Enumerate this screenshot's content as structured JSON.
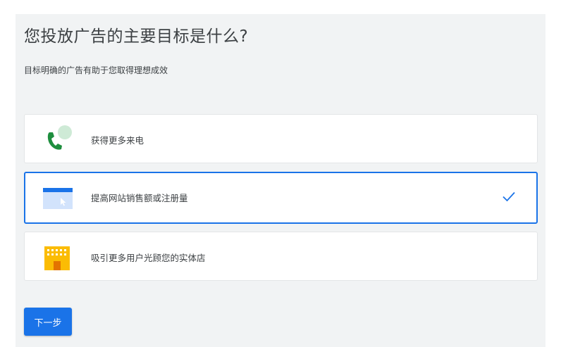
{
  "header": {
    "title": "您投放广告的主要目标是什么?",
    "subtitle": "目标明确的广告有助于您取得理想成效"
  },
  "options": [
    {
      "label": "获得更多来电",
      "icon": "phone-call-icon",
      "selected": false
    },
    {
      "label": "提高网站销售额或注册量",
      "icon": "website-cursor-icon",
      "selected": true
    },
    {
      "label": "吸引更多用户光顾您的实体店",
      "icon": "storefront-icon",
      "selected": false
    }
  ],
  "actions": {
    "next_label": "下一步"
  },
  "colors": {
    "accent": "#1a73e8",
    "phone_green": "#1e8e3e",
    "bubble_green": "#ceead6",
    "store_yellow": "#fbbc04",
    "panel_bg": "#f1f3f4"
  }
}
